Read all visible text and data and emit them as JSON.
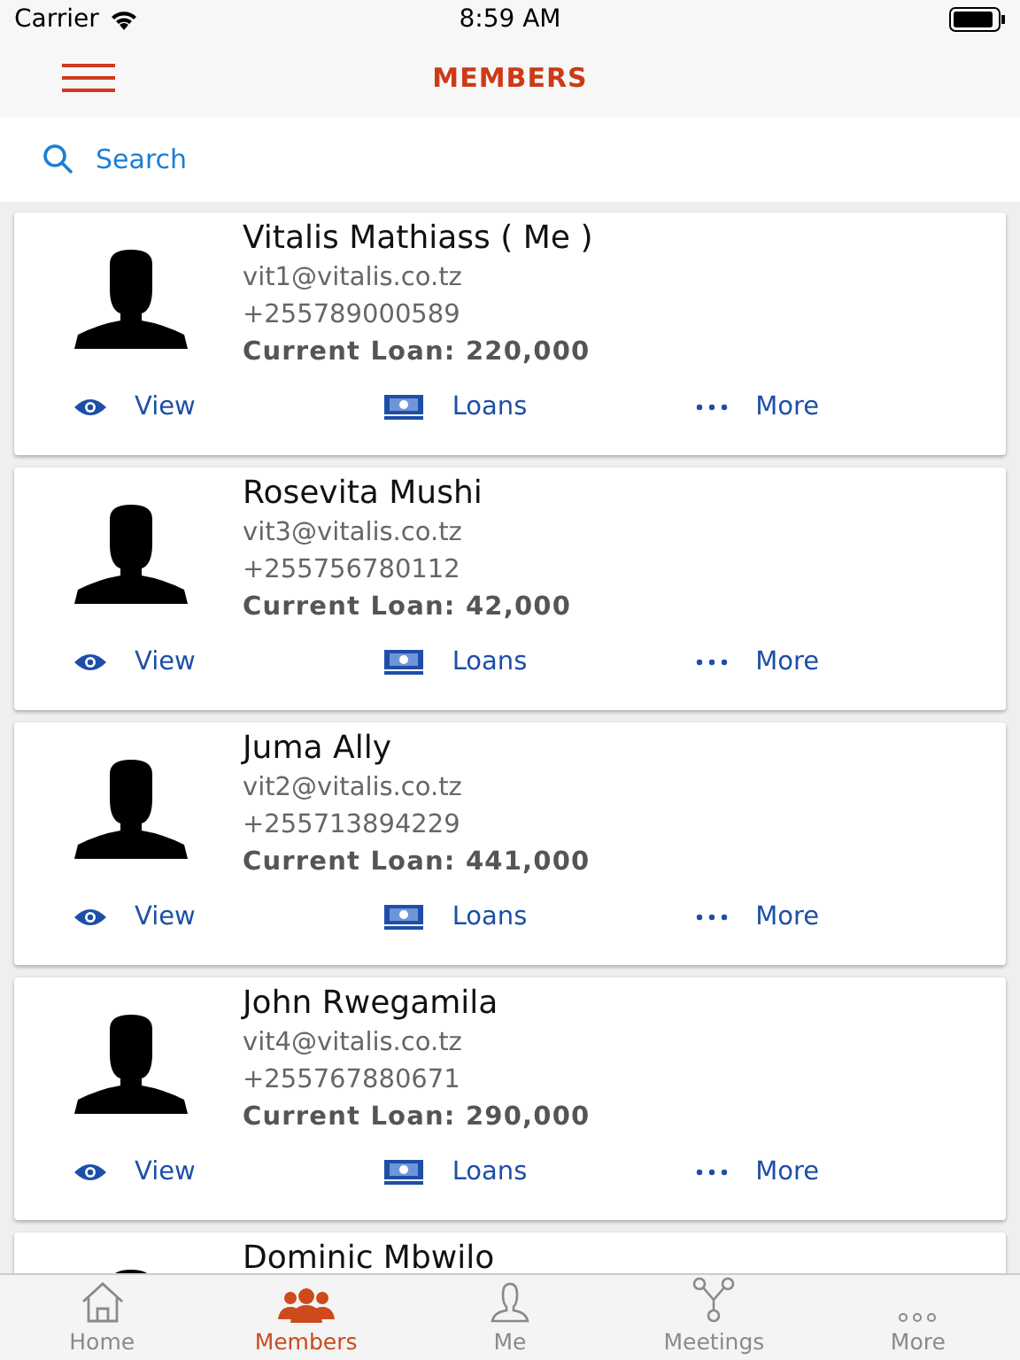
{
  "status_bar": {
    "carrier": "Carrier",
    "time": "8:59 AM"
  },
  "nav_bar": {
    "title": "MEMBERS"
  },
  "search": {
    "placeholder": "Search"
  },
  "members": [
    {
      "name": "Vitalis Mathiass ( Me )",
      "email": "vit1@vitalis.co.tz",
      "phone": "+255789000589",
      "loan_label": "Current Loan:",
      "loan": "220,000",
      "actions": [
        "View",
        "Loans",
        "More"
      ]
    },
    {
      "name": "Rosevita Mushi",
      "email": "vit3@vitalis.co.tz",
      "phone": "+255756780112",
      "loan_label": "Current Loan:",
      "loan": "42,000",
      "actions": [
        "View",
        "Loans",
        "More"
      ]
    },
    {
      "name": "Juma Ally",
      "email": "vit2@vitalis.co.tz",
      "phone": "+255713894229",
      "loan_label": "Current Loan:",
      "loan": "441,000",
      "actions": [
        "View",
        "Loans",
        "More"
      ]
    },
    {
      "name": "John Rwegamila",
      "email": "vit4@vitalis.co.tz",
      "phone": "+255767880671",
      "loan_label": "Current Loan:",
      "loan": "290,000",
      "actions": [
        "View",
        "Loans",
        "More"
      ]
    },
    {
      "name": "Dominic Mbwilo"
    }
  ],
  "tab_bar": [
    {
      "label": "Home",
      "selected": false
    },
    {
      "label": "Members",
      "selected": true
    },
    {
      "label": "Me",
      "selected": false
    },
    {
      "label": "Meetings",
      "selected": false
    },
    {
      "label": "More",
      "selected": false
    }
  ]
}
